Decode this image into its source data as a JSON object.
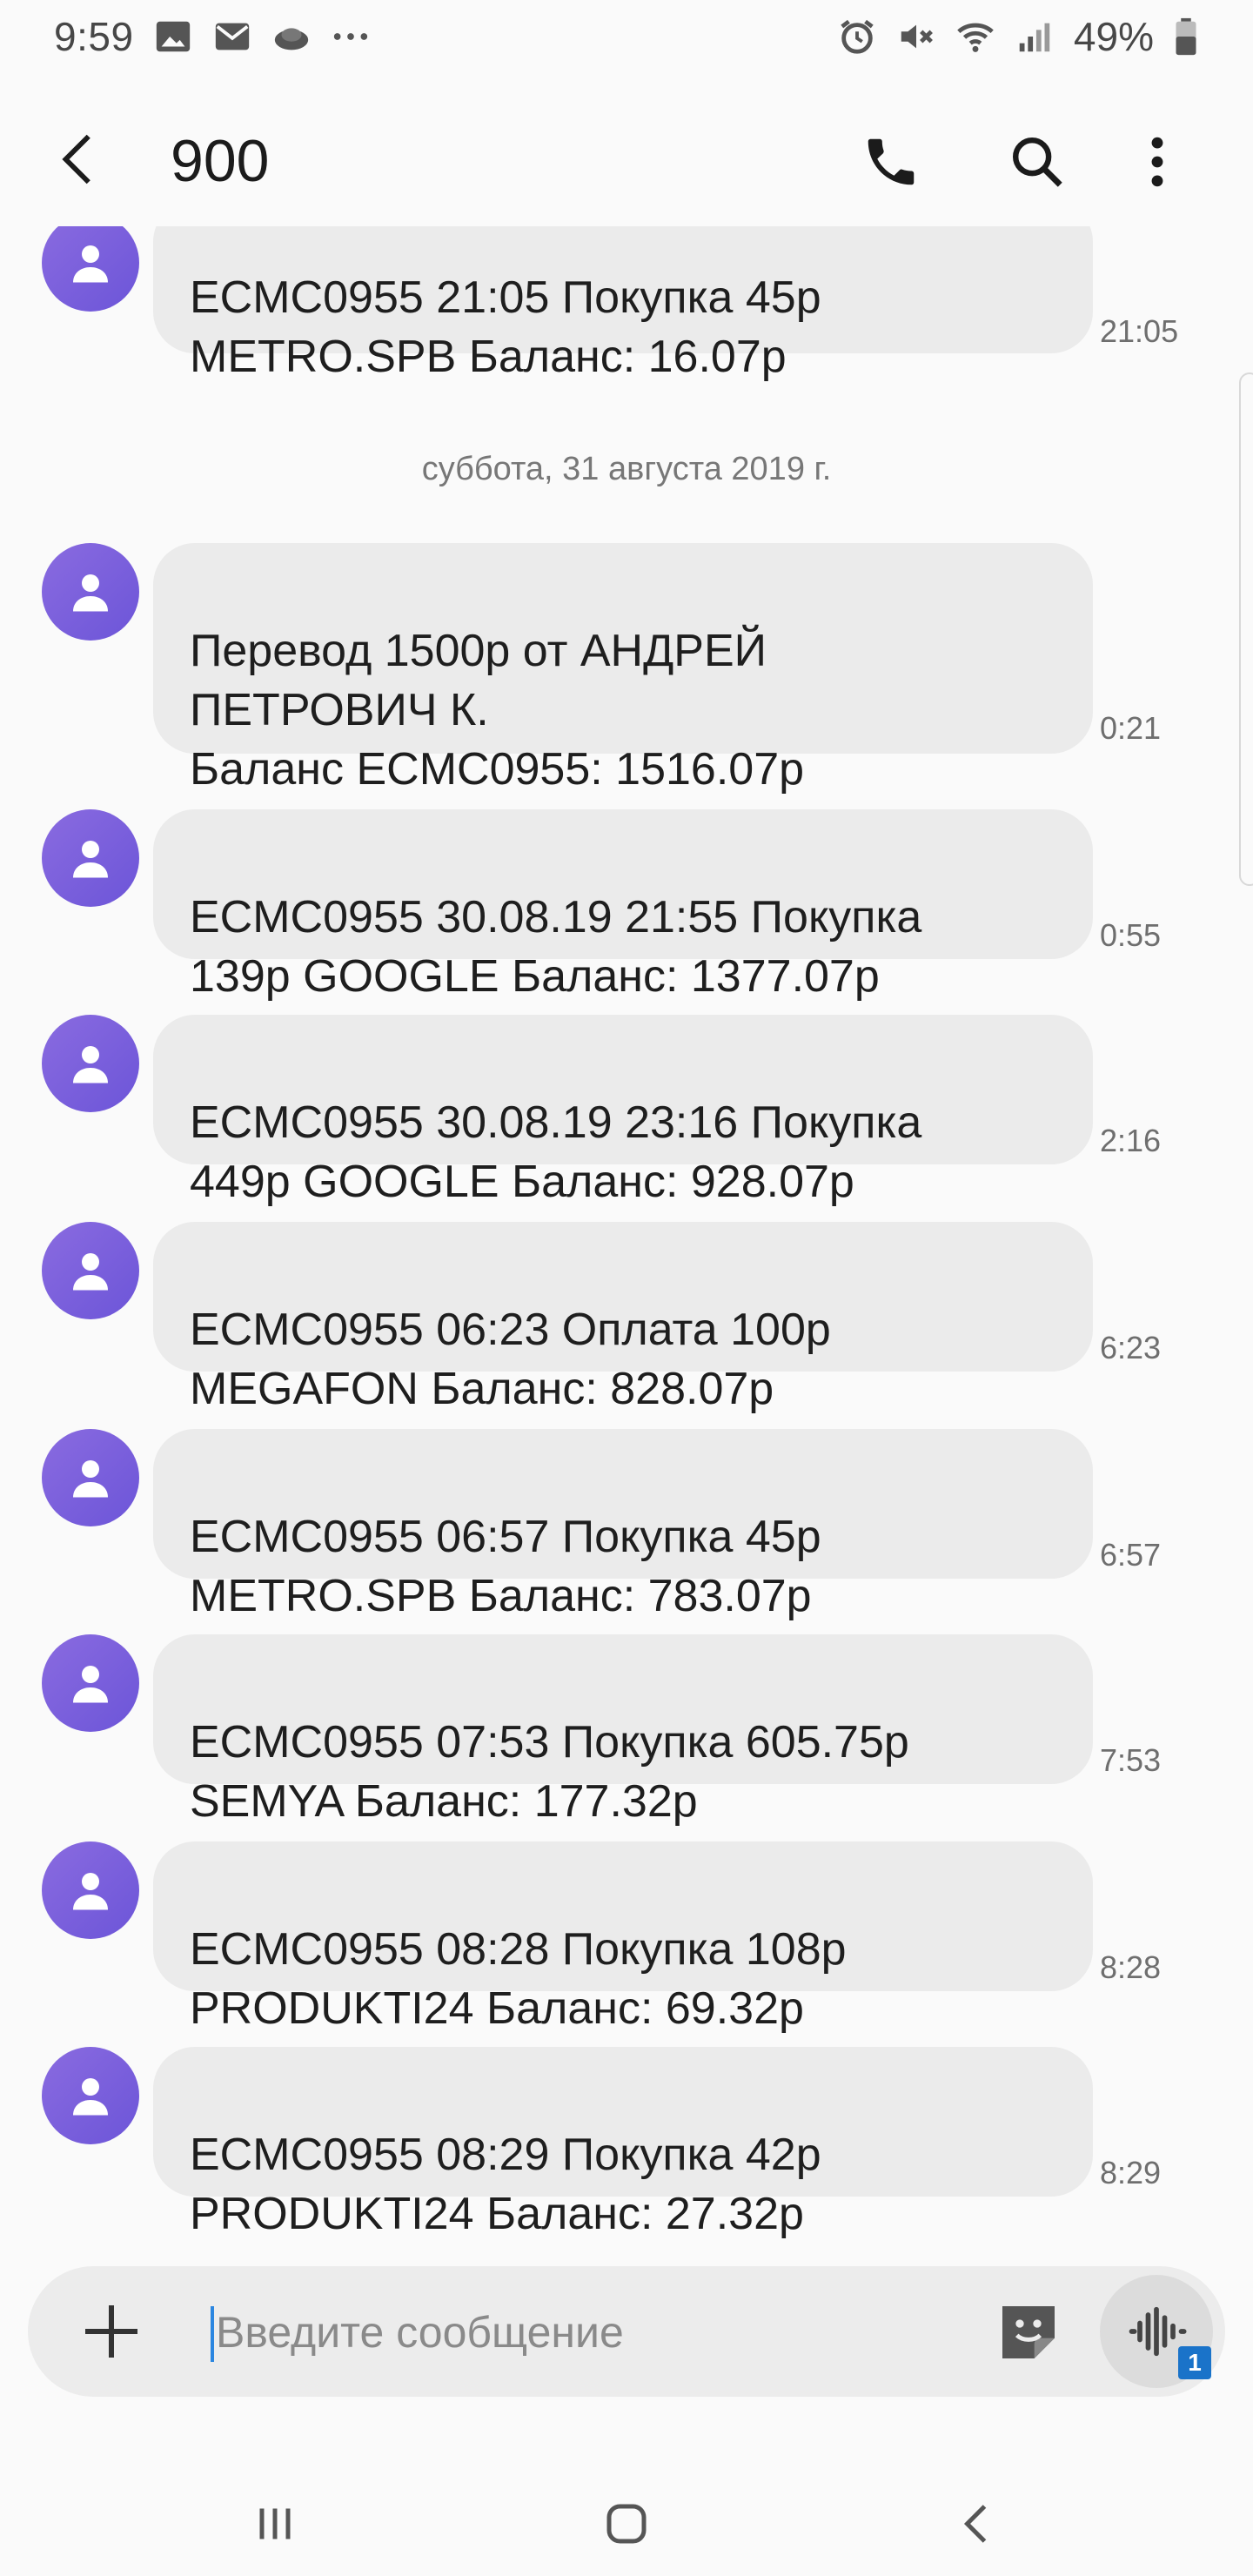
{
  "status_bar": {
    "time": "9:59",
    "battery_percent": "49%",
    "left_icons": [
      "gallery-icon",
      "mail-icon",
      "weather-icon",
      "more-dots-icon"
    ],
    "right_icons": [
      "alarm-icon",
      "mute-icon",
      "wifi-icon",
      "signal-icon",
      "battery-icon"
    ]
  },
  "header": {
    "title": "900",
    "actions": [
      "phone-icon",
      "search-icon",
      "more-vert-icon"
    ]
  },
  "thread": {
    "top_partial": {
      "text": "ECMC0955 21:05 Покупка 45р\nMETRO.SPB Баланс: 16.07р",
      "time": "21:05"
    },
    "date_divider": "суббота, 31 августа 2019 г.",
    "messages": [
      {
        "text": "Перевод 1500р от АНДРЕЙ\nПЕТРОВИЧ К.\nБаланс ECMC0955: 1516.07р",
        "time": "0:21"
      },
      {
        "text": "ECMC0955 30.08.19 21:55 Покупка\n139р GOOGLE Баланс: 1377.07р",
        "time": "0:55"
      },
      {
        "text": "ECMC0955 30.08.19 23:16 Покупка\n449р GOOGLE Баланс: 928.07р",
        "time": "2:16"
      },
      {
        "text": "ECMC0955 06:23 Оплата 100р\nMEGAFON Баланс: 828.07р",
        "time": "6:23"
      },
      {
        "text": "ECMC0955 06:57 Покупка 45р\nMETRO.SPB Баланс: 783.07р",
        "time": "6:57"
      },
      {
        "text": "ECMC0955 07:53 Покупка 605.75р\nSEMYA Баланс: 177.32р",
        "time": "7:53"
      },
      {
        "text": "ECMC0955 08:28 Покупка 108р\nPRODUKTI24 Баланс: 69.32р",
        "time": "8:28"
      },
      {
        "text": "ECMC0955 08:29 Покупка 42р\nPRODUKTI24 Баланс: 27.32р",
        "time": "8:29"
      }
    ]
  },
  "composer": {
    "placeholder": "Введите сообщение",
    "value": "",
    "voice_badge": "1"
  },
  "colors": {
    "avatar": "#7b62dd",
    "bubble": "#ebebeb",
    "accent": "#1a73c9"
  }
}
